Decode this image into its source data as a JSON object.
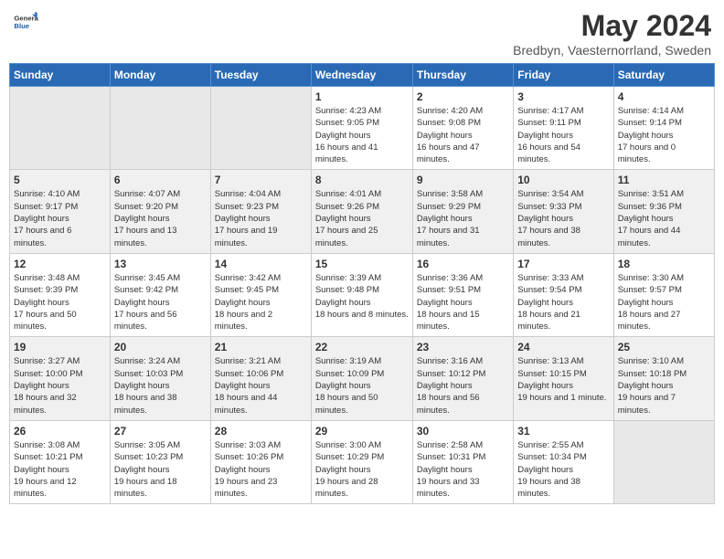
{
  "header": {
    "logo": {
      "general": "General",
      "blue": "Blue"
    },
    "month": "May 2024",
    "location": "Bredbyn, Vaesternorrland, Sweden"
  },
  "weekdays": [
    "Sunday",
    "Monday",
    "Tuesday",
    "Wednesday",
    "Thursday",
    "Friday",
    "Saturday"
  ],
  "weeks": [
    [
      {
        "day": "",
        "empty": true
      },
      {
        "day": "",
        "empty": true
      },
      {
        "day": "",
        "empty": true
      },
      {
        "day": "1",
        "sunrise": "4:23 AM",
        "sunset": "9:05 PM",
        "daylight": "16 hours and 41 minutes."
      },
      {
        "day": "2",
        "sunrise": "4:20 AM",
        "sunset": "9:08 PM",
        "daylight": "16 hours and 47 minutes."
      },
      {
        "day": "3",
        "sunrise": "4:17 AM",
        "sunset": "9:11 PM",
        "daylight": "16 hours and 54 minutes."
      },
      {
        "day": "4",
        "sunrise": "4:14 AM",
        "sunset": "9:14 PM",
        "daylight": "17 hours and 0 minutes."
      }
    ],
    [
      {
        "day": "5",
        "sunrise": "4:10 AM",
        "sunset": "9:17 PM",
        "daylight": "17 hours and 6 minutes."
      },
      {
        "day": "6",
        "sunrise": "4:07 AM",
        "sunset": "9:20 PM",
        "daylight": "17 hours and 13 minutes."
      },
      {
        "day": "7",
        "sunrise": "4:04 AM",
        "sunset": "9:23 PM",
        "daylight": "17 hours and 19 minutes."
      },
      {
        "day": "8",
        "sunrise": "4:01 AM",
        "sunset": "9:26 PM",
        "daylight": "17 hours and 25 minutes."
      },
      {
        "day": "9",
        "sunrise": "3:58 AM",
        "sunset": "9:29 PM",
        "daylight": "17 hours and 31 minutes."
      },
      {
        "day": "10",
        "sunrise": "3:54 AM",
        "sunset": "9:33 PM",
        "daylight": "17 hours and 38 minutes."
      },
      {
        "day": "11",
        "sunrise": "3:51 AM",
        "sunset": "9:36 PM",
        "daylight": "17 hours and 44 minutes."
      }
    ],
    [
      {
        "day": "12",
        "sunrise": "3:48 AM",
        "sunset": "9:39 PM",
        "daylight": "17 hours and 50 minutes."
      },
      {
        "day": "13",
        "sunrise": "3:45 AM",
        "sunset": "9:42 PM",
        "daylight": "17 hours and 56 minutes."
      },
      {
        "day": "14",
        "sunrise": "3:42 AM",
        "sunset": "9:45 PM",
        "daylight": "18 hours and 2 minutes."
      },
      {
        "day": "15",
        "sunrise": "3:39 AM",
        "sunset": "9:48 PM",
        "daylight": "18 hours and 8 minutes."
      },
      {
        "day": "16",
        "sunrise": "3:36 AM",
        "sunset": "9:51 PM",
        "daylight": "18 hours and 15 minutes."
      },
      {
        "day": "17",
        "sunrise": "3:33 AM",
        "sunset": "9:54 PM",
        "daylight": "18 hours and 21 minutes."
      },
      {
        "day": "18",
        "sunrise": "3:30 AM",
        "sunset": "9:57 PM",
        "daylight": "18 hours and 27 minutes."
      }
    ],
    [
      {
        "day": "19",
        "sunrise": "3:27 AM",
        "sunset": "10:00 PM",
        "daylight": "18 hours and 32 minutes."
      },
      {
        "day": "20",
        "sunrise": "3:24 AM",
        "sunset": "10:03 PM",
        "daylight": "18 hours and 38 minutes."
      },
      {
        "day": "21",
        "sunrise": "3:21 AM",
        "sunset": "10:06 PM",
        "daylight": "18 hours and 44 minutes."
      },
      {
        "day": "22",
        "sunrise": "3:19 AM",
        "sunset": "10:09 PM",
        "daylight": "18 hours and 50 minutes."
      },
      {
        "day": "23",
        "sunrise": "3:16 AM",
        "sunset": "10:12 PM",
        "daylight": "18 hours and 56 minutes."
      },
      {
        "day": "24",
        "sunrise": "3:13 AM",
        "sunset": "10:15 PM",
        "daylight": "19 hours and 1 minute."
      },
      {
        "day": "25",
        "sunrise": "3:10 AM",
        "sunset": "10:18 PM",
        "daylight": "19 hours and 7 minutes."
      }
    ],
    [
      {
        "day": "26",
        "sunrise": "3:08 AM",
        "sunset": "10:21 PM",
        "daylight": "19 hours and 12 minutes."
      },
      {
        "day": "27",
        "sunrise": "3:05 AM",
        "sunset": "10:23 PM",
        "daylight": "19 hours and 18 minutes."
      },
      {
        "day": "28",
        "sunrise": "3:03 AM",
        "sunset": "10:26 PM",
        "daylight": "19 hours and 23 minutes."
      },
      {
        "day": "29",
        "sunrise": "3:00 AM",
        "sunset": "10:29 PM",
        "daylight": "19 hours and 28 minutes."
      },
      {
        "day": "30",
        "sunrise": "2:58 AM",
        "sunset": "10:31 PM",
        "daylight": "19 hours and 33 minutes."
      },
      {
        "day": "31",
        "sunrise": "2:55 AM",
        "sunset": "10:34 PM",
        "daylight": "19 hours and 38 minutes."
      },
      {
        "day": "",
        "empty": true
      }
    ]
  ],
  "labels": {
    "sunrise": "Sunrise:",
    "sunset": "Sunset:",
    "daylight": "Daylight hours"
  }
}
